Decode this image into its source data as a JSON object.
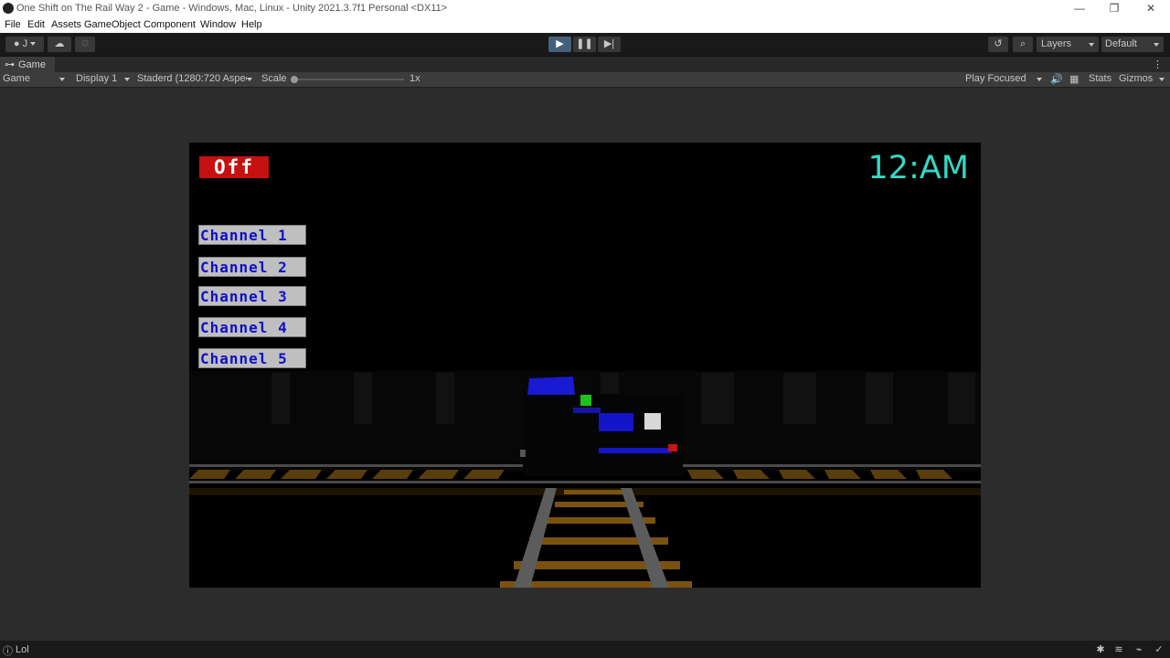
{
  "window": {
    "title": "One Shift on The Rail Way 2 - Game - Windows, Mac, Linux - Unity 2021.3.7f1 Personal <DX11>",
    "controls": [
      "minimize-icon",
      "restore-icon",
      "close-icon"
    ]
  },
  "menu": [
    "File",
    "Edit",
    "Assets",
    "GameObject",
    "Component",
    "Window",
    "Help"
  ],
  "toolbar": {
    "account_label": "J",
    "layers_label": "Layers",
    "layout_label": "Default"
  },
  "tab": {
    "label": "Game"
  },
  "gamebar": {
    "mode": "Game",
    "display": "Display 1",
    "aspect": "Staderd (1280:720 Aspec",
    "scale_label": "Scale",
    "scale_value": "1x",
    "scale_slider_fraction": 0.0,
    "play_mode": "Play Focused",
    "stats": "Stats",
    "gizmos": "Gizmos"
  },
  "game": {
    "off_label": "Off",
    "clock": "12:AM",
    "channels": [
      "Channel 1",
      "Channel 2",
      "Channel 3",
      "Channel 4",
      "Channel 5"
    ],
    "colors": {
      "off_bg": "#c51111",
      "clock": "#33d9c6",
      "channel_text": "#1010c8",
      "channel_bg": "#bfbfbf",
      "train_blue": "#1414c8",
      "rail_wood": "#6b4a12",
      "rail_metal": "#5a5a5a"
    }
  },
  "status": {
    "message": "Lol"
  }
}
